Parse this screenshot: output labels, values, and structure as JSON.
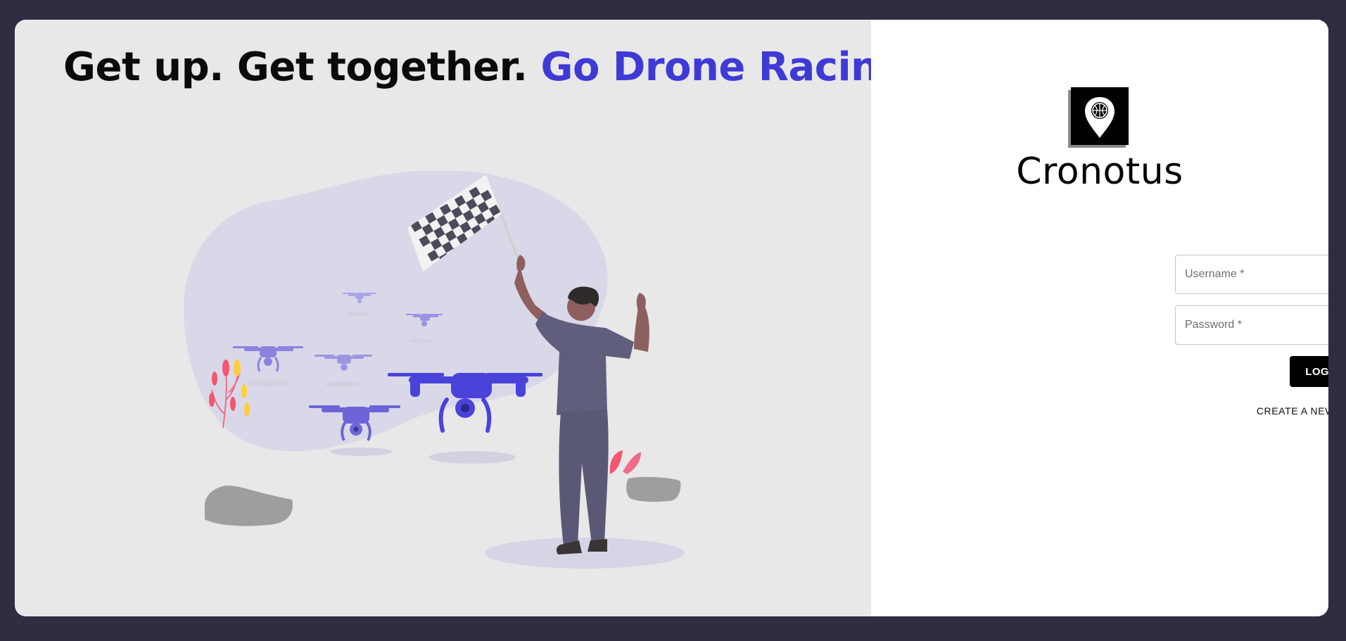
{
  "hero": {
    "headline_part1": "Get up. Get together. ",
    "headline_accent": "Go Drone Racing!",
    "illustration": "drone-racing-illustration"
  },
  "brand": {
    "name": "Cronotus",
    "logo_icon": "map-pin-ball-icon"
  },
  "login_form": {
    "username_placeholder": "Username *",
    "password_placeholder": "Password *",
    "visibility_icon": "eye-off-icon",
    "login_label": "LOGIN",
    "create_account_label": "CREATE A NEW ACCOUNT"
  },
  "colors": {
    "page_background": "#2e2d42",
    "accent": "#3f3ad6",
    "left_panel": "#e8e8e9",
    "button": "#000000"
  }
}
